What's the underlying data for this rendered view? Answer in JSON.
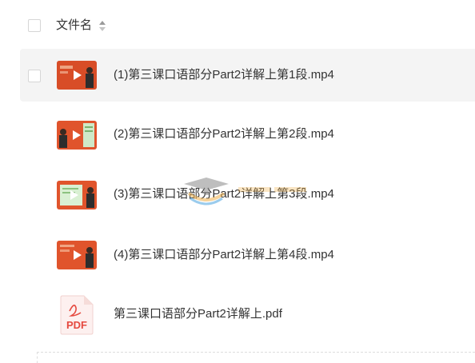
{
  "header": {
    "column_label": "文件名"
  },
  "files": [
    {
      "name": "(1)第三课口语部分Part2详解上第1段.mp4",
      "type": "video",
      "selected": true
    },
    {
      "name": "(2)第三课口语部分Part2详解上第2段.mp4",
      "type": "video"
    },
    {
      "name": "(3)第三课口语部分Part2详解上第3段.mp4",
      "type": "video"
    },
    {
      "name": "(4)第三课口语部分Part2详解上第4段.mp4",
      "type": "video"
    },
    {
      "name": "第三课口语部分Part2详解上.pdf",
      "type": "pdf",
      "badge": "PDF"
    }
  ],
  "colors": {
    "row_selected_bg": "#f4f4f4",
    "thumb_orange": "#e0542c",
    "pdf_red": "#e5493f"
  },
  "icons": {
    "sort": "sort-icon",
    "pdf": "pdf-icon",
    "play": "play-icon"
  }
}
